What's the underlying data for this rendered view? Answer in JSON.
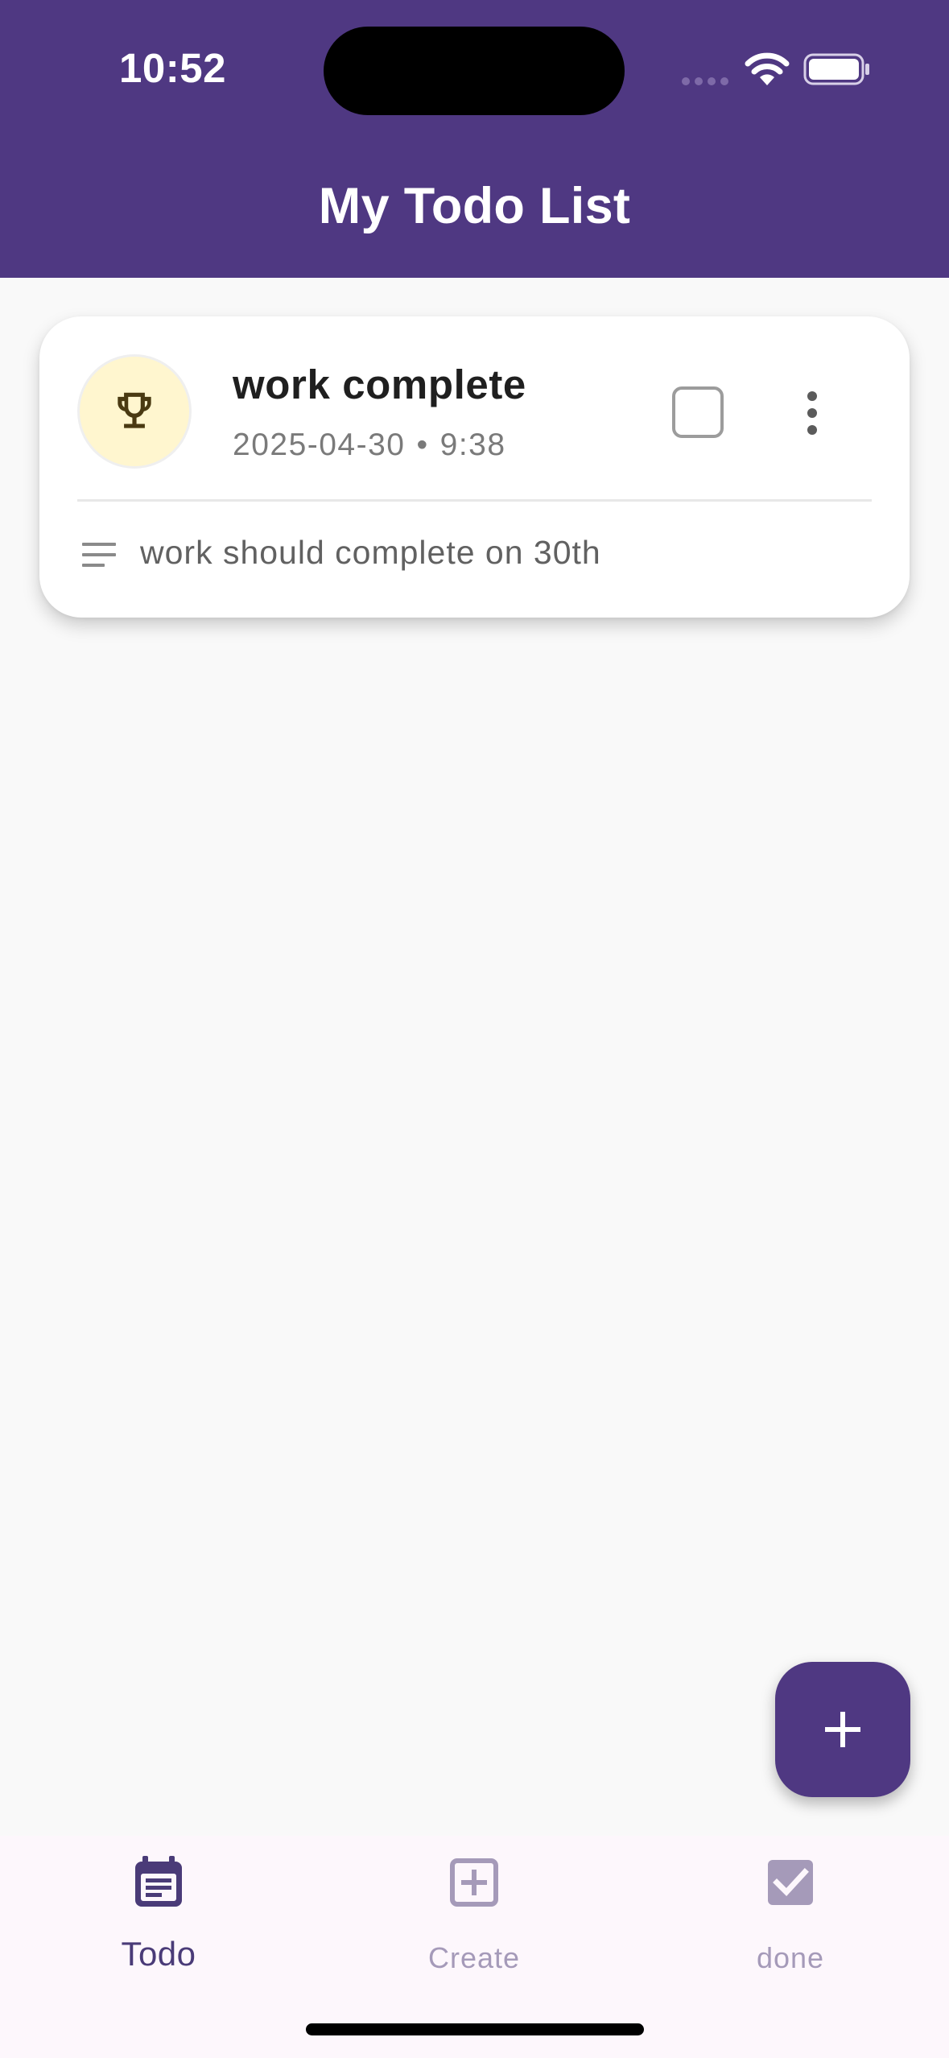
{
  "status_bar": {
    "time": "10:52"
  },
  "header": {
    "title": "My Todo List"
  },
  "todos": [
    {
      "title": "work complete",
      "date": "2025-04-30",
      "separator": "•",
      "time": "9:38",
      "notes": "work should complete on 30th",
      "category_icon": "trophy-icon",
      "completed": false
    }
  ],
  "fab": {
    "icon": "plus-icon"
  },
  "bottom_nav": {
    "items": [
      {
        "label": "Todo",
        "icon": "calendar-list-icon",
        "active": true
      },
      {
        "label": "Create",
        "icon": "add-box-icon",
        "active": false
      },
      {
        "label": "done",
        "icon": "checkbox-checked-icon",
        "active": false
      }
    ]
  },
  "colors": {
    "primary": "#4f3882",
    "avatar_bg": "#fff6cf",
    "nav_bg": "#fdf7fc",
    "nav_active": "#4a3b78",
    "nav_inactive": "#a59ab9",
    "page_bg": "#f9f9f9"
  }
}
